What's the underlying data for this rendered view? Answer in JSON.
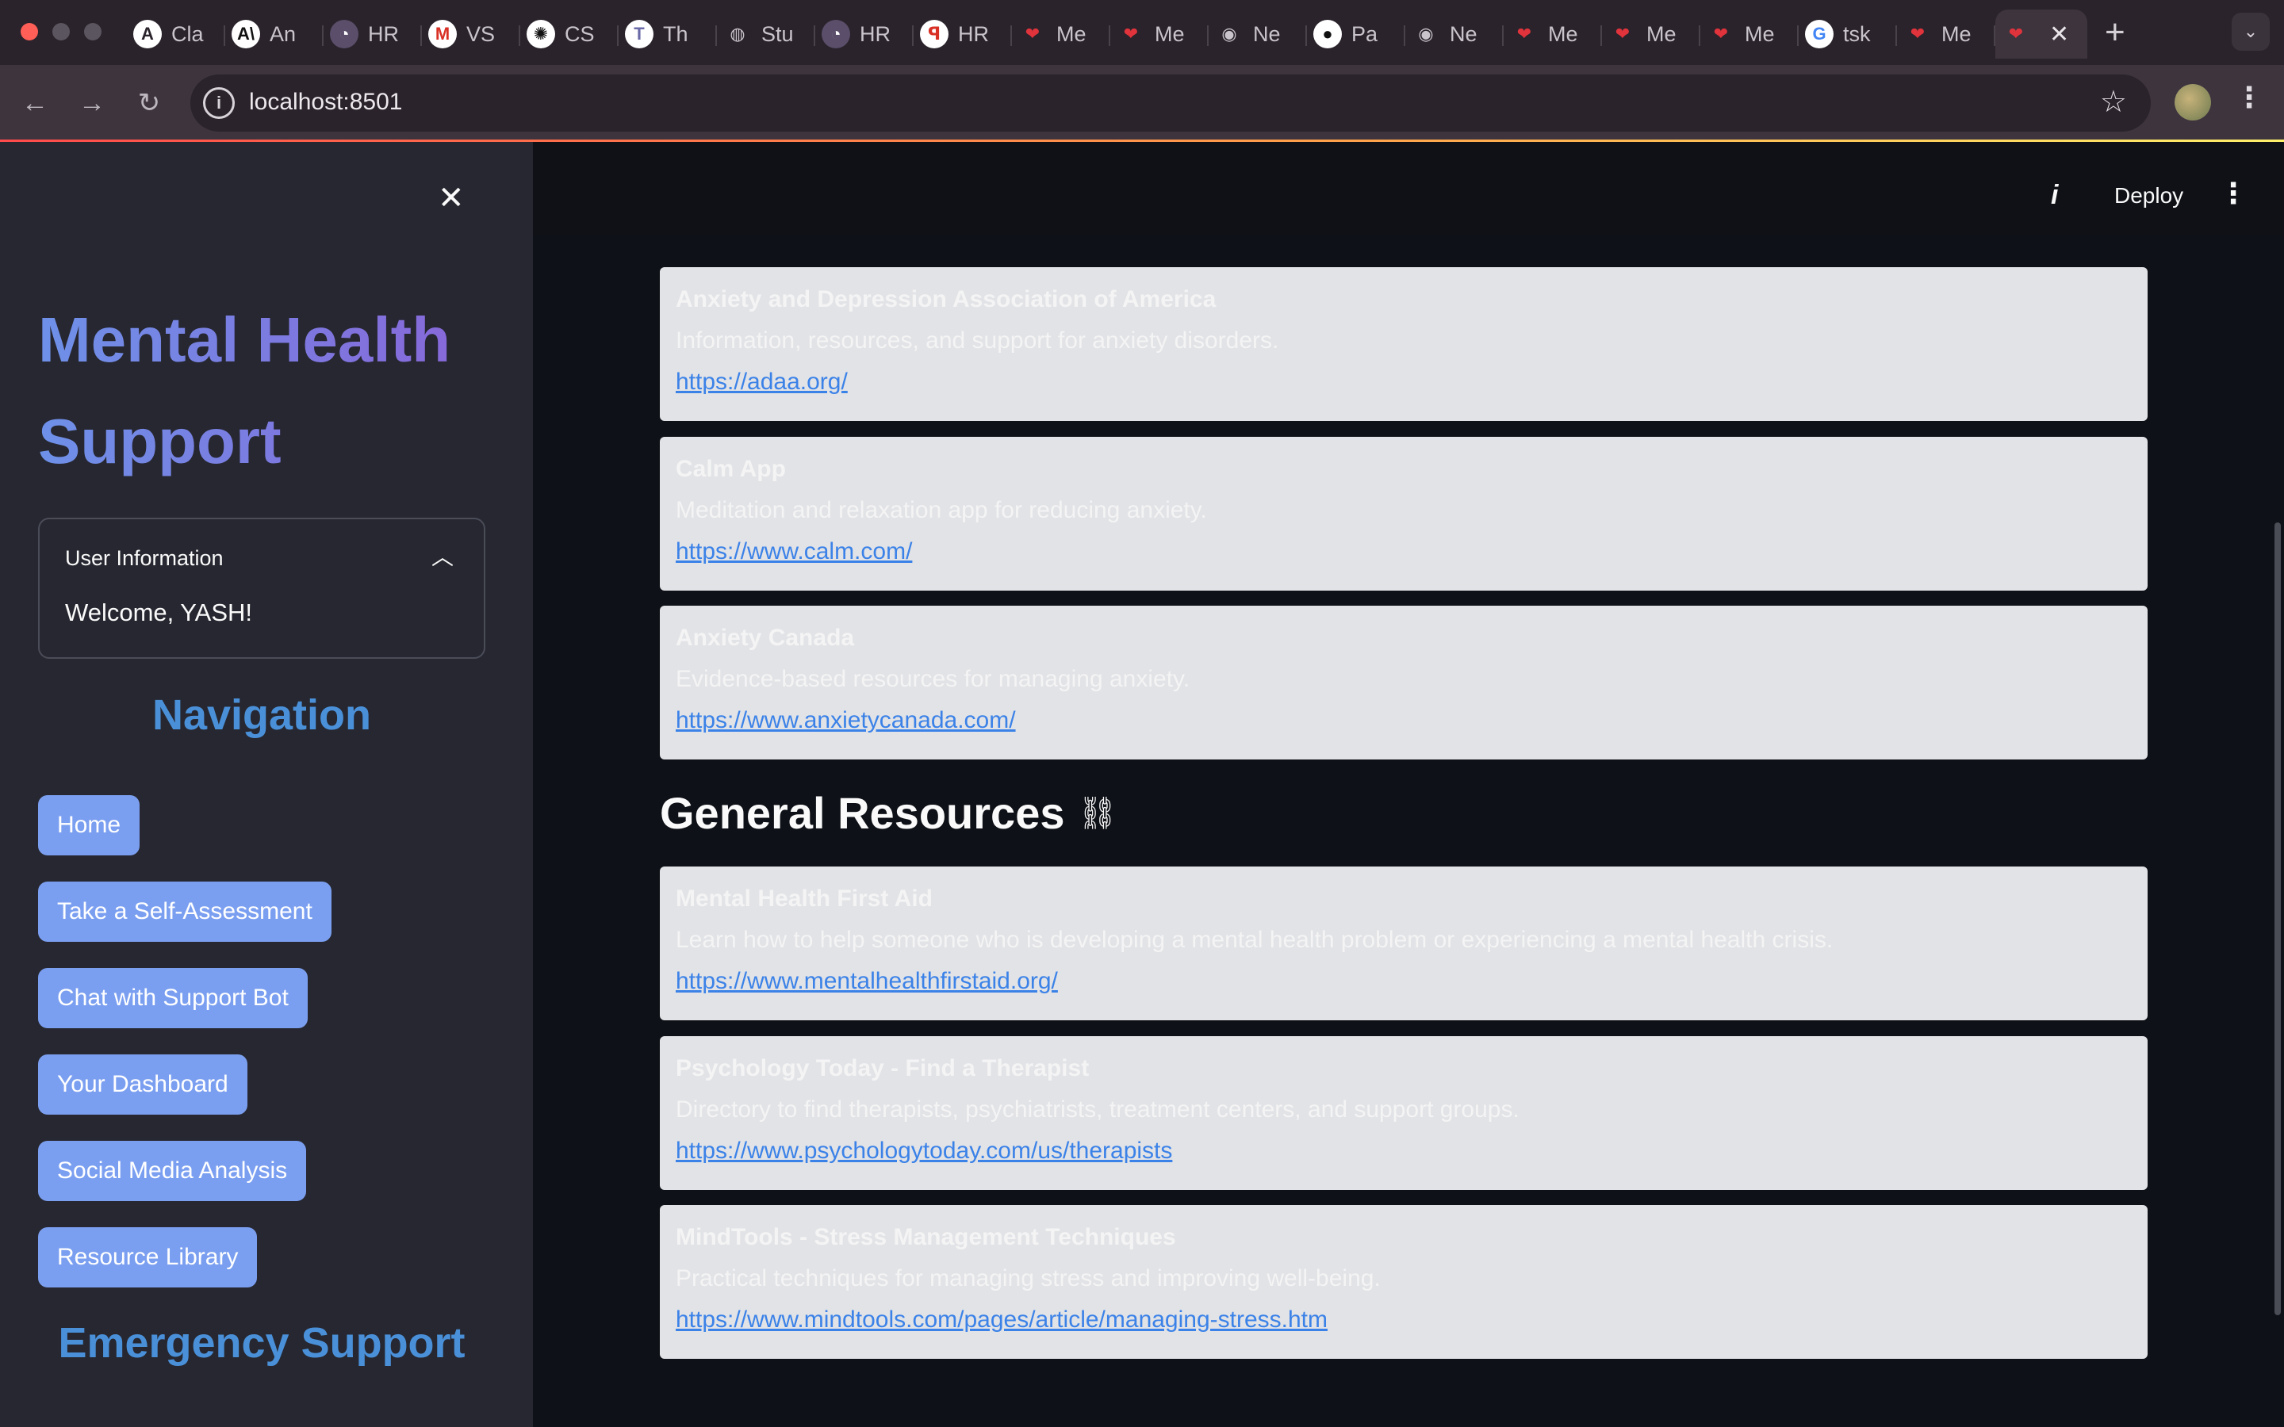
{
  "browser": {
    "tabs": [
      {
        "title": "Cla",
        "icon": "claude-icon",
        "bg": "#ffffff",
        "fg": "#2a232b",
        "glyph": "A"
      },
      {
        "title": "An",
        "icon": "anthropic-icon",
        "bg": "#ffffff",
        "fg": "#111111",
        "glyph": "A\\"
      },
      {
        "title": "HR",
        "icon": "hackerrank-icon",
        "bg": "#5a4e6a",
        "fg": "#ffffff",
        "glyph": "◔"
      },
      {
        "title": "VS",
        "icon": "gmail-icon",
        "bg": "#ffffff",
        "fg": "#d93025",
        "glyph": "M"
      },
      {
        "title": "CS",
        "icon": "chatgpt-icon",
        "bg": "#ffffff",
        "fg": "#111111",
        "glyph": "✺"
      },
      {
        "title": "Th",
        "icon": "tk-icon",
        "bg": "#ffffff",
        "fg": "#6a6aa8",
        "glyph": "T"
      },
      {
        "title": "Stu",
        "icon": "globe-icon",
        "bg": "#2a232b",
        "fg": "#c9c3cb",
        "glyph": "◍"
      },
      {
        "title": "HR",
        "icon": "hackerrank-icon",
        "bg": "#5a4e6a",
        "fg": "#ffffff",
        "glyph": "◔"
      },
      {
        "title": "HR",
        "icon": "hr-logo-icon",
        "bg": "#ffffff",
        "fg": "#d93025",
        "glyph": "ꟼ"
      },
      {
        "title": "Me",
        "icon": "heart-icon",
        "bg": "transparent",
        "fg": "#e0333c",
        "glyph": "❤"
      },
      {
        "title": "Me",
        "icon": "heart-icon",
        "bg": "transparent",
        "fg": "#e0333c",
        "glyph": "❤"
      },
      {
        "title": "Ne",
        "icon": "chrome-icon",
        "bg": "#2a232b",
        "fg": "#c9c3cb",
        "glyph": "◉"
      },
      {
        "title": "Pa",
        "icon": "github-icon",
        "bg": "#ffffff",
        "fg": "#111111",
        "glyph": "●"
      },
      {
        "title": "Ne",
        "icon": "chrome-icon",
        "bg": "#2a232b",
        "fg": "#c9c3cb",
        "glyph": "◉"
      },
      {
        "title": "Me",
        "icon": "heart-icon",
        "bg": "transparent",
        "fg": "#e0333c",
        "glyph": "❤"
      },
      {
        "title": "Me",
        "icon": "heart-icon",
        "bg": "transparent",
        "fg": "#e0333c",
        "glyph": "❤"
      },
      {
        "title": "Me",
        "icon": "heart-icon",
        "bg": "transparent",
        "fg": "#e0333c",
        "glyph": "❤"
      },
      {
        "title": "tsk",
        "icon": "google-icon",
        "bg": "#ffffff",
        "fg": "#4285f4",
        "glyph": "G"
      },
      {
        "title": "Me",
        "icon": "heart-icon",
        "bg": "transparent",
        "fg": "#e0333c",
        "glyph": "❤"
      }
    ],
    "active_tab": {
      "icon": "heart-icon",
      "glyph": "❤",
      "fg": "#e0333c"
    },
    "url": "localhost:8501"
  },
  "sidebar": {
    "title_line1": "Mental Health",
    "title_line2": "Support",
    "user_info": {
      "header": "User Information",
      "welcome": "Welcome, YASH!"
    },
    "nav_heading": "Navigation",
    "nav_buttons": [
      "Home",
      "Take a Self-Assessment",
      "Chat with Support Bot",
      "Your Dashboard",
      "Social Media Analysis",
      "Resource Library"
    ],
    "emergency_heading": "Emergency Support"
  },
  "header": {
    "deploy_label": "Deploy"
  },
  "main": {
    "anxiety_resources": [
      {
        "title": "Anxiety and Depression Association of America",
        "description": "Information, resources, and support for anxiety disorders.",
        "url": "https://adaa.org/"
      },
      {
        "title": "Calm App",
        "description": "Meditation and relaxation app for reducing anxiety.",
        "url": "https://www.calm.com/"
      },
      {
        "title": "Anxiety Canada",
        "description": "Evidence-based resources for managing anxiety.",
        "url": "https://www.anxietycanada.com/"
      }
    ],
    "general_heading": "General Resources",
    "general_resources": [
      {
        "title": "Mental Health First Aid",
        "description": "Learn how to help someone who is developing a mental health problem or experiencing a mental health crisis.",
        "url": "https://www.mentalhealthfirstaid.org/"
      },
      {
        "title": "Psychology Today - Find a Therapist",
        "description": "Directory to find therapists, psychiatrists, treatment centers, and support groups.",
        "url": "https://www.psychologytoday.com/us/therapists"
      },
      {
        "title": "MindTools - Stress Management Techniques",
        "description": "Practical techniques for managing stress and improving well-being.",
        "url": "https://www.mindtools.com/pages/article/managing-stress.htm"
      }
    ]
  },
  "colors": {
    "accent_button": "#7b9ff0",
    "heading_blue": "#4a90d9",
    "link": "#3b82e8",
    "card_bg": "#e2e3e6"
  }
}
